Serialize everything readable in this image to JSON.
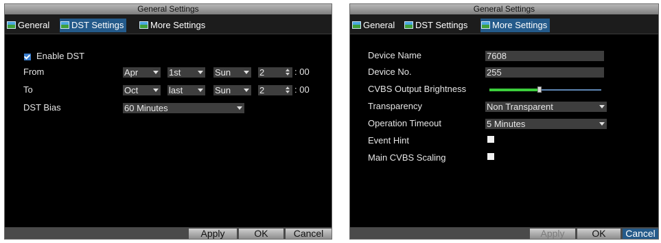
{
  "left_panel": {
    "title": "General Settings",
    "tabs": [
      {
        "label": "General",
        "active": false
      },
      {
        "label": "DST Settings",
        "active": true
      },
      {
        "label": "More Settings",
        "active": false
      }
    ],
    "enable_dst": {
      "label": "Enable DST",
      "checked": true
    },
    "from": {
      "label": "From",
      "month": "Apr",
      "week": "1st",
      "day": "Sun",
      "hour": "2",
      "minutes": ": 00"
    },
    "to": {
      "label": "To",
      "month": "Oct",
      "week": "last",
      "day": "Sun",
      "hour": "2",
      "minutes": ": 00"
    },
    "dst_bias": {
      "label": "DST Bias",
      "value": "60 Minutes"
    },
    "buttons": {
      "apply": "Apply",
      "ok": "OK",
      "cancel": "Cancel"
    }
  },
  "right_panel": {
    "title": "General Settings",
    "tabs": [
      {
        "label": "General",
        "active": false
      },
      {
        "label": "DST Settings",
        "active": false
      },
      {
        "label": "More Settings",
        "active": true
      }
    ],
    "device_name": {
      "label": "Device Name",
      "value": "7608"
    },
    "device_no": {
      "label": "Device No.",
      "value": "255"
    },
    "cvbs_brightness": {
      "label": "CVBS Output Brightness",
      "level": 0.45
    },
    "transparency": {
      "label": "Transparency",
      "value": "Non Transparent"
    },
    "operation_timeout": {
      "label": "Operation Timeout",
      "value": "5 Minutes"
    },
    "event_hint": {
      "label": "Event Hint",
      "checked": false
    },
    "main_cvbs_scaling": {
      "label": "Main CVBS Scaling",
      "checked": false
    },
    "buttons": {
      "apply": "Apply",
      "ok": "OK",
      "cancel": "Cancel"
    }
  },
  "colors": {
    "tab_active": "#245a8a",
    "slider_fill": "#3ccf3c",
    "panel_bg": "#000000"
  }
}
